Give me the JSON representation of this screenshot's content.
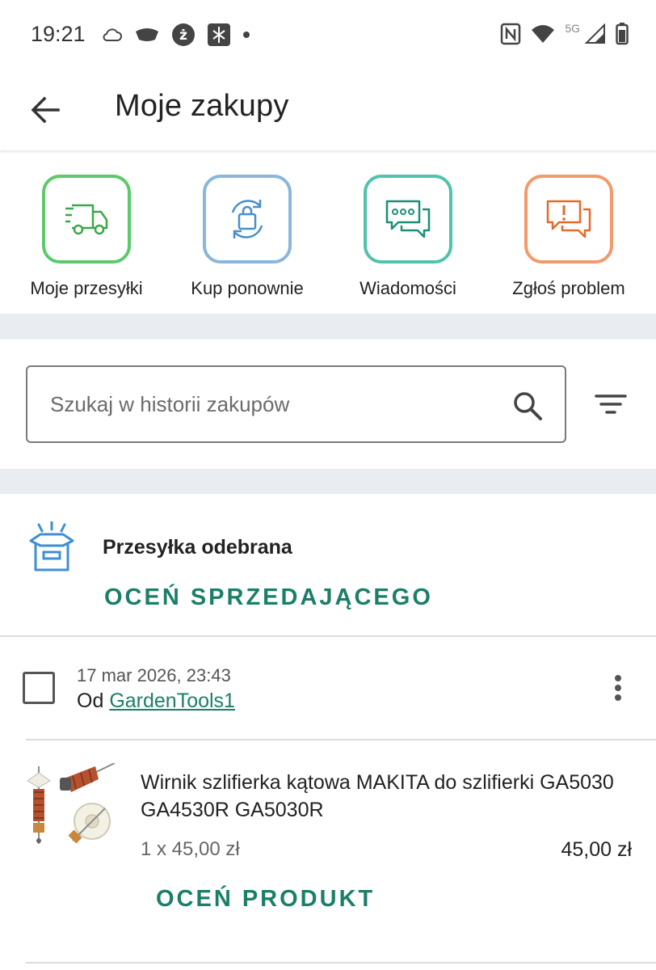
{
  "status_bar": {
    "time": "19:21",
    "network_label": "5G",
    "icons": [
      "cloud-icon",
      "wear-icon",
      "zabka-app-icon",
      "sync-app-icon",
      "notification-dot-icon",
      "nfc-icon",
      "wifi-icon",
      "signal-icon",
      "battery-icon"
    ]
  },
  "app_bar": {
    "title": "Moje zakupy",
    "back_icon": "arrow-back-icon"
  },
  "quick_actions": [
    {
      "label": "Moje przesyłki",
      "icon": "truck-icon",
      "color": "#5cc96a"
    },
    {
      "label": "Kup ponownie",
      "icon": "rebuy-bag-icon",
      "color": "#8ab6dc"
    },
    {
      "label": "Wiadomości",
      "icon": "chat-icon",
      "color": "#4fc3ad"
    },
    {
      "label": "Zgłoś problem",
      "icon": "report-problem-icon",
      "color": "#f29a6a"
    }
  ],
  "search": {
    "placeholder": "Szukaj w historii zakupów",
    "value": ""
  },
  "order": {
    "shipment_status": "Przesyłka odebrana",
    "rate_seller_label": "OCEŃ SPRZEDAJĄCEGO",
    "date": "17 mar 2026, 23:43",
    "seller_prefix": "Od",
    "seller_name": "GardenTools1",
    "item": {
      "title": "Wirnik szlifierka kątowa MAKITA do szlifierki GA5030 GA4530R GA5030R",
      "quantity_price": "1 x 45,00 zł",
      "total": "45,00 zł",
      "rate_product_label": "OCEŃ PRODUKT"
    }
  },
  "colors": {
    "accent": "#1b7f68",
    "separator": "#e9edf1",
    "box_icon": "#3f8fd2"
  }
}
